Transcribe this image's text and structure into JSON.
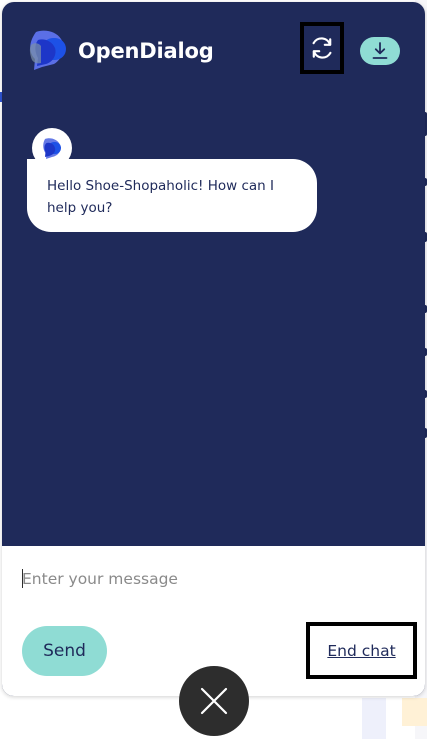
{
  "app": {
    "brand": "OpenDialog"
  },
  "header": {
    "refresh_icon": "refresh-icon",
    "download_icon": "download-icon"
  },
  "transcript": {
    "messages": [
      {
        "sender": "bot",
        "avatar_icon": "opendialog-logo-icon",
        "text": "Hello Shoe-Shopaholic! How can I help you?"
      }
    ]
  },
  "composer": {
    "placeholder": "Enter your message",
    "value": "",
    "send_label": "Send",
    "end_chat_label": "End chat"
  },
  "launcher": {
    "close_icon": "close-icon"
  },
  "colors": {
    "panel": "#1f2a5a",
    "accent": "#8fdcd4",
    "bubble": "#ffffff",
    "composer": "#ffffff",
    "fab": "#2d2d2d",
    "focus_border": "#000000"
  }
}
